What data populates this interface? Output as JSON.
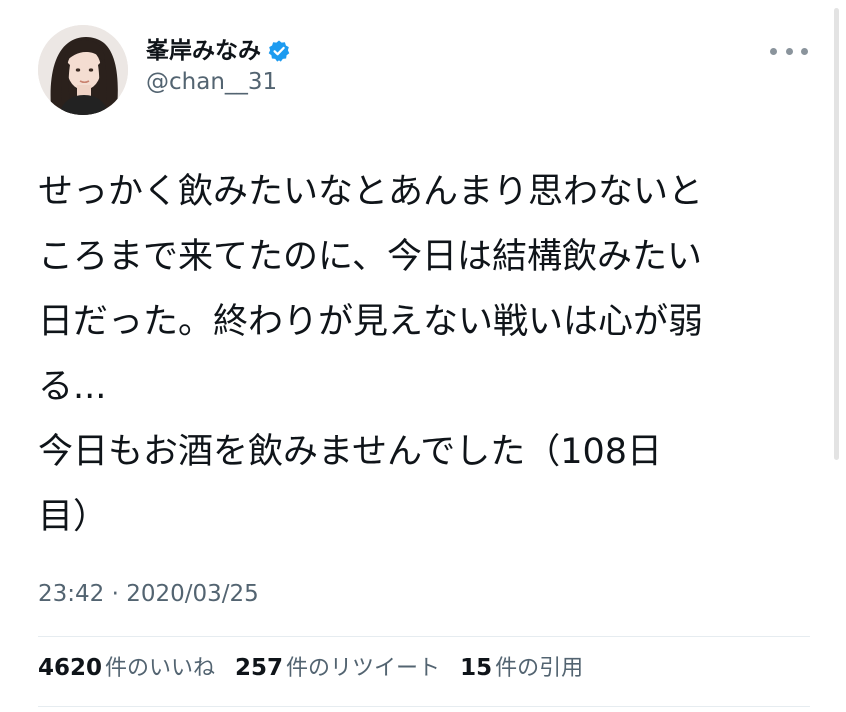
{
  "author": {
    "display_name": "峯岸みなみ",
    "handle": "@chan__31",
    "verified_icon": "verified-badge-icon",
    "avatar_icon": "profile-photo"
  },
  "tweet": {
    "lines": [
      "せっかく飲みたいなとあんまり思わないと",
      "ころまで来てたのに、今日は結構飲みたい",
      "日だった。終わりが見えない戦いは心が弱",
      "る...",
      "今日もお酒を飲みませんでした（108日",
      "目）"
    ],
    "timestamp": "23:42 · 2020/03/25"
  },
  "stats": {
    "likes_count": "4620",
    "likes_label": "件のいいね",
    "retweets_count": "257",
    "retweets_label": "件のリツイート",
    "quotes_count": "15",
    "quotes_label": "件の引用"
  },
  "colors": {
    "primary_text": "#0f1419",
    "secondary_text": "#536471",
    "verified_blue": "#1d9bf0",
    "divider": "#e6ecf0"
  }
}
